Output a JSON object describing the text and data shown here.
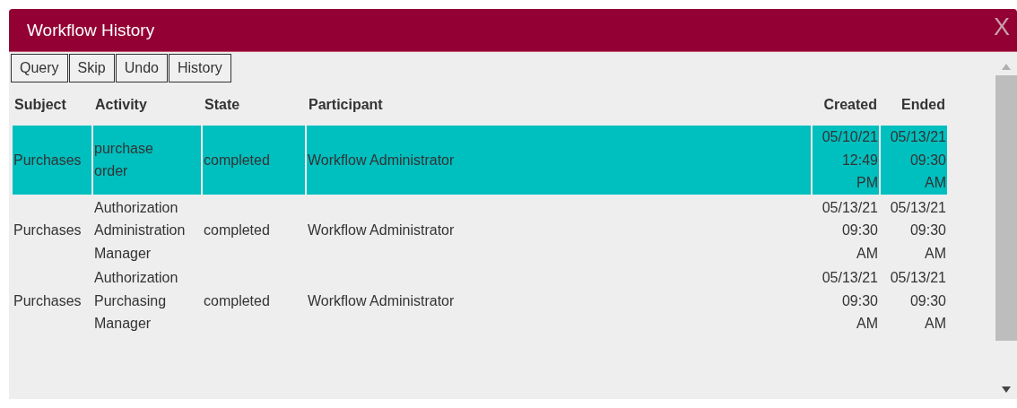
{
  "window": {
    "title": "Workflow History",
    "close": "X"
  },
  "toolbar": [
    "Query",
    "Skip",
    "Undo",
    "History"
  ],
  "table": {
    "columns": [
      "Subject",
      "Activity",
      "State",
      "Participant",
      "Created",
      "Ended"
    ],
    "rows": [
      {
        "selected": true,
        "cells": [
          "Purchases",
          "purchase\norder",
          "completed",
          "Workflow Administrator",
          "05/10/21\n12:49\nPM",
          "05/13/21\n09:30\nAM"
        ]
      },
      {
        "selected": false,
        "cells": [
          "Purchases",
          "Authorization\nAdministration\nManager",
          "completed",
          "Workflow Administrator",
          "05/13/21\n09:30\nAM",
          "05/13/21\n09:30\nAM"
        ]
      },
      {
        "selected": false,
        "cells": [
          "Purchases",
          "Authorization\nPurchasing\nManager",
          "completed",
          "Workflow Administrator",
          "05/13/21\n09:30\nAM",
          "05/13/21\n09:30\nAM"
        ]
      }
    ]
  }
}
